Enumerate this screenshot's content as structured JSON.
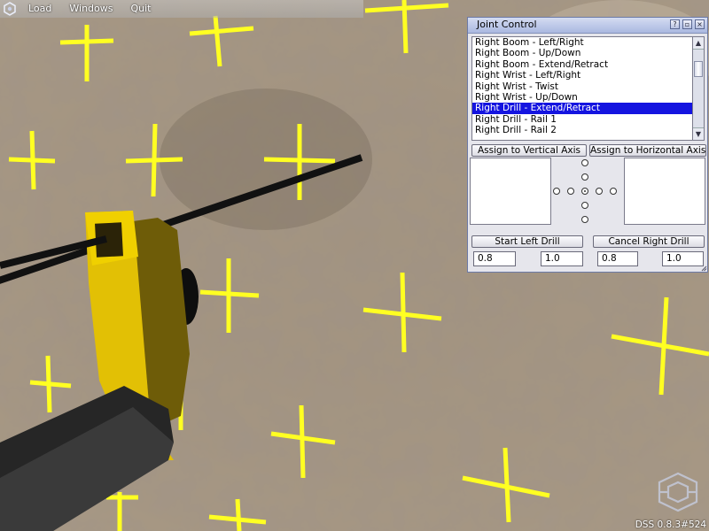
{
  "menubar": {
    "items": [
      "Load",
      "Windows",
      "Quit"
    ]
  },
  "joint_window": {
    "title": "Joint Control",
    "list_items": [
      "Right Boom - Left/Right",
      "Right Boom - Up/Down",
      "Right Boom - Extend/Retract",
      "Right Wrist - Left/Right",
      "Right Wrist - Twist",
      "Right Wrist - Up/Down",
      "Right Drill - Extend/Retract",
      "Right Drill - Rail 1",
      "Right Drill - Rail 2"
    ],
    "selected_index": 6,
    "assign_vertical_label": "Assign to Vertical Axis",
    "assign_horizontal_label": "Assign to Horizontal Axis",
    "start_left_drill_label": "Start Left Drill",
    "cancel_right_drill_label": "Cancel Right Drill",
    "fields": [
      "0.8",
      "1.0",
      "0.8",
      "1.0"
    ]
  },
  "status": {
    "version": "DSS 0.8.3#524"
  },
  "colors": {
    "accent_selected": "#1414e0",
    "marker_yellow": "#ffff22",
    "machine_yellow": "#e8c400",
    "ground": "#9a8870"
  }
}
